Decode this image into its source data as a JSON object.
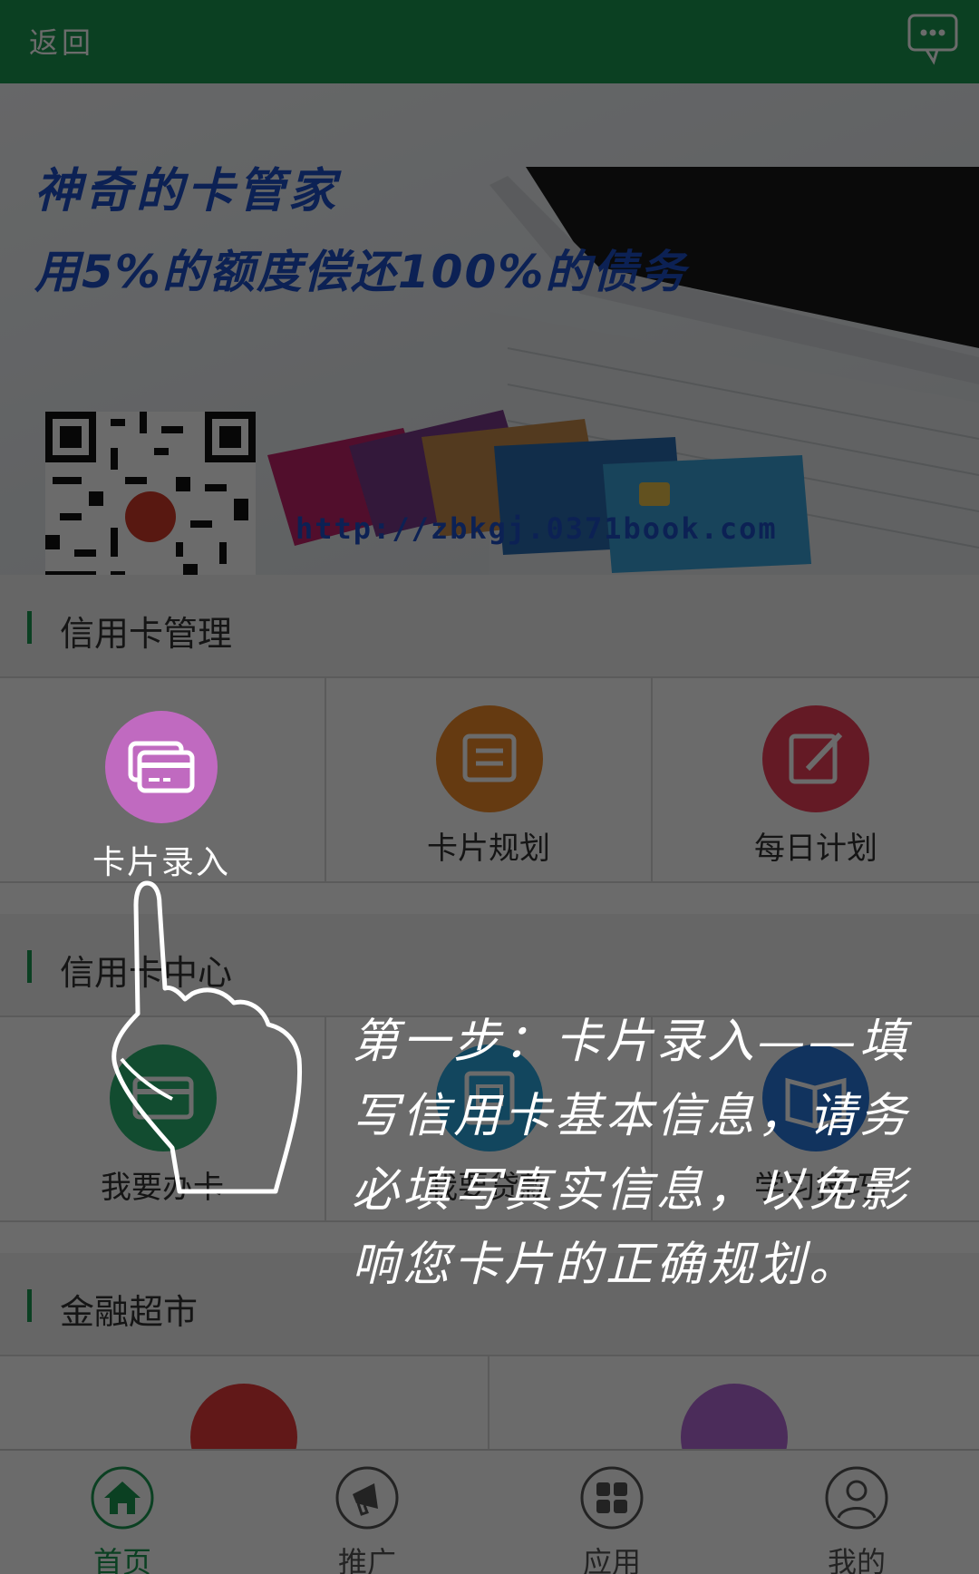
{
  "header": {
    "back_label": "返回",
    "message_icon": "chat-bubble-icon"
  },
  "banner": {
    "title_line1": "神奇的卡管家",
    "title_line2": "用5%的额度偿还100%的债务",
    "url": "http://zbkgj.0371book.com"
  },
  "sections": {
    "card_management": {
      "title": "信用卡管理",
      "items": [
        {
          "label": "卡片录入",
          "icon": "cards-icon",
          "color": "#c06ac0"
        },
        {
          "label": "卡片规划",
          "icon": "list-document-icon",
          "color": "#f08a2a"
        },
        {
          "label": "每日计划",
          "icon": "edit-pen-icon",
          "color": "#ee3f5a"
        }
      ]
    },
    "card_center": {
      "title": "信用卡中心",
      "items": [
        {
          "label": "我要办卡",
          "icon": "credit-card-icon",
          "color": "#2bb673"
        },
        {
          "label": "我要贷款",
          "icon": "loan-icon",
          "color": "#2ba8e0"
        },
        {
          "label": "学习技巧",
          "icon": "book-icon",
          "color": "#2a7ae0"
        }
      ]
    },
    "finance_market": {
      "title": "金融超市",
      "items": [
        {
          "label": "",
          "icon": "card-red-icon",
          "color": "#e83a3a"
        },
        {
          "label": "",
          "icon": "bag-icon",
          "color": "#b36ad6"
        }
      ]
    }
  },
  "tip": {
    "text": "第一步：卡片录入——填写信用卡基本信息，请务必填写真实信息，以免影响您卡片的正确规划。"
  },
  "tabbar": {
    "tabs": [
      {
        "label": "首页",
        "icon": "home-icon",
        "active": true
      },
      {
        "label": "推广",
        "icon": "megaphone-icon",
        "active": false
      },
      {
        "label": "应用",
        "icon": "apps-grid-icon",
        "active": false
      },
      {
        "label": "我的",
        "icon": "user-icon",
        "active": false
      }
    ]
  },
  "colors": {
    "brand_green": "#1b9a52",
    "banner_blue": "#1d4fc8"
  }
}
